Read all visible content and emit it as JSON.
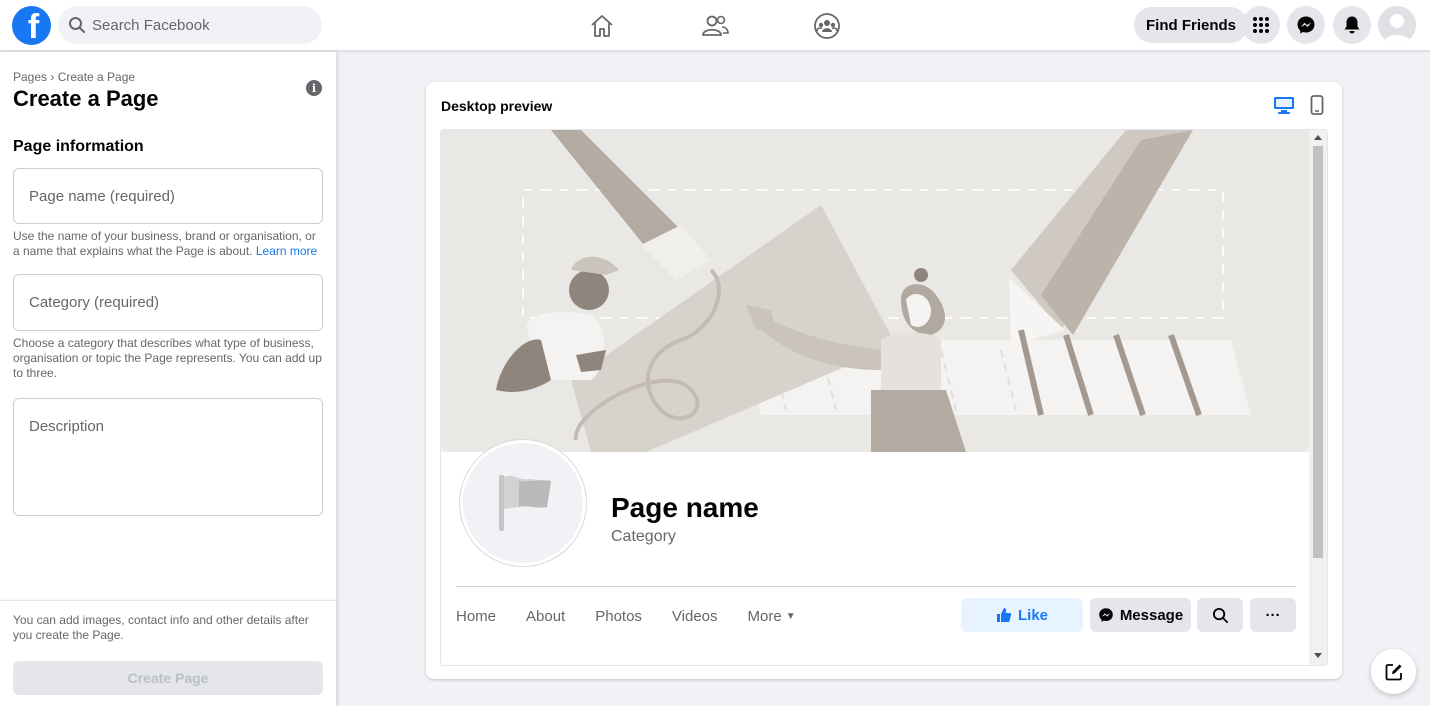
{
  "topbar": {
    "logo_letter": "f",
    "search_placeholder": "Search Facebook",
    "nav_icons": [
      "home-icon",
      "friends-icon",
      "groups-icon"
    ],
    "find_friends_label": "Find Friends",
    "right_icons": [
      "menu-grid-icon",
      "messenger-icon",
      "bell-icon"
    ]
  },
  "left": {
    "breadcrumb": "Pages › Create a Page",
    "title": "Create a Page",
    "section_title": "Page information",
    "page_name_placeholder": "Page name (required)",
    "page_name_help": "Use the name of your business, brand or organisation, or a name that explains what the Page is about.",
    "learn_more": "Learn more",
    "category_placeholder": "Category (required)",
    "category_help": "Choose a category that describes what type of business, organisation or topic the Page represents. You can add up to three.",
    "description_placeholder": "Description",
    "footer_note": "You can add images, contact info and other details after you create the Page.",
    "create_button": "Create Page"
  },
  "preview": {
    "title": "Desktop preview",
    "page_name": "Page name",
    "category": "Category",
    "tabs": [
      "Home",
      "About",
      "Photos",
      "Videos",
      "More"
    ],
    "like_label": "Like",
    "message_label": "Message",
    "more_actions": "···"
  },
  "colors": {
    "brand": "#1877f2",
    "background": "#f0f2f5",
    "secondary_text": "#65676b"
  }
}
